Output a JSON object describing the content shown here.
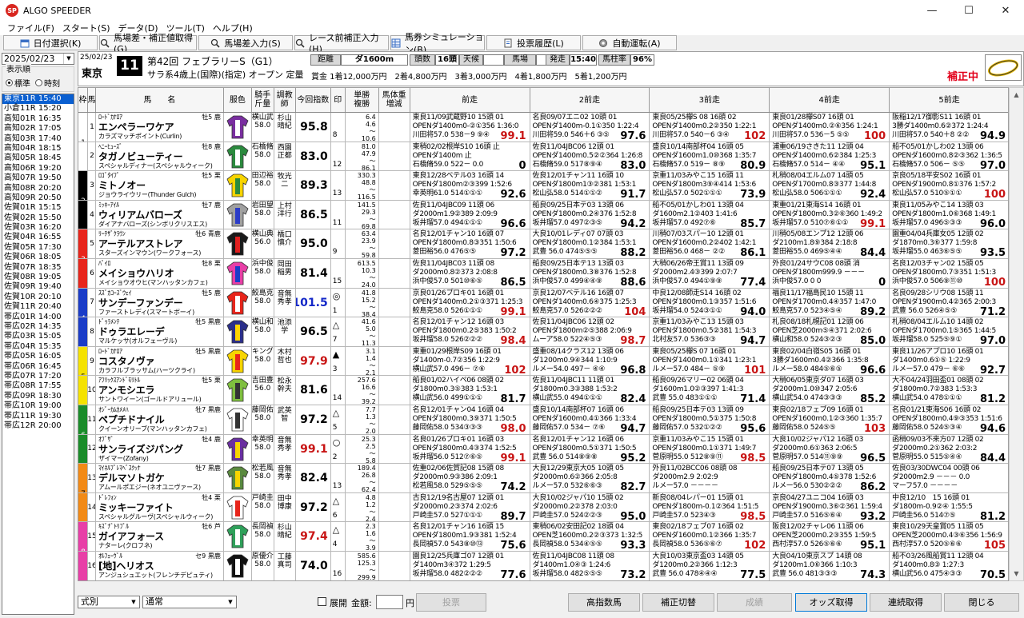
{
  "window": {
    "title": "ALGO SPEEDER",
    "app_icon": "SP"
  },
  "menu": [
    "ファイル(F)",
    "スタート(S)",
    "データ(D)",
    "ツール(T)",
    "ヘルプ(H)"
  ],
  "toolbar": [
    {
      "label": "日付選択(K)",
      "icon": "calendar-icon"
    },
    {
      "label": "馬場差・補正値取得(G)",
      "icon": "search-icon"
    },
    {
      "label": "馬場差入力(S)",
      "icon": "search-icon"
    },
    {
      "label": "レース前補正入力(H)",
      "icon": "search-icon"
    },
    {
      "label": "馬券シミュレーション(B)",
      "icon": "grid-icon"
    },
    {
      "label": "投票履歴(L)",
      "icon": "list-icon"
    },
    {
      "label": "自動運転(A)",
      "icon": "gear-icon"
    }
  ],
  "left": {
    "date": "2025/02/23",
    "order_label": "表示順",
    "order_options": [
      "標準",
      "時刻"
    ],
    "order_selected": 0,
    "races": [
      "東京11R 15:40",
      "小倉11R 15:20",
      "高知01R 16:35",
      "高知02R 17:05",
      "高知03R 17:40",
      "高知04R 18:15",
      "高知05R 18:45",
      "高知06R 19:20",
      "高知07R 19:50",
      "高知08R 20:20",
      "高知09R 20:50",
      "佐賀01R 15:15",
      "佐賀02R 15:50",
      "佐賀03R 16:20",
      "佐賀04R 16:55",
      "佐賀05R 17:30",
      "佐賀06R 18:05",
      "佐賀07R 18:35",
      "佐賀08R 19:05",
      "佐賀09R 19:40",
      "佐賀10R 20:10",
      "佐賀11R 20:40",
      "帯広01R 14:00",
      "帯広02R 14:35",
      "帯広03R 15:05",
      "帯広04R 15:35",
      "帯広05R 16:05",
      "帯広06R 16:45",
      "帯広07R 17:20",
      "帯広08R 17:55",
      "帯広09R 18:30",
      "帯広10R 19:00",
      "帯広11R 19:30",
      "帯広12R 20:00"
    ],
    "selected": 0
  },
  "header": {
    "date": "25/02/23",
    "place": "東京",
    "race_no": "11",
    "race_name": "第42回 フェブラリーS（G1）",
    "conditions": "サラ系4歳上(国際)(指定) オープン 定量",
    "distance_label": "距離",
    "distance": "ダ1600m",
    "heads_label": "頭数",
    "heads": "16頭",
    "weather_label": "天候",
    "weather": "",
    "track_label": "馬場",
    "track": "",
    "post_label": "発走",
    "post": "15:40",
    "ratio_label": "馬柱率",
    "ratio": "96%",
    "prize": "賞金 1着12,000万円　2着4,800万円　3着3,000万円　4着1,800万円　5着1,200万円",
    "status": "補正中"
  },
  "columns": [
    "枠",
    "馬",
    "馬　　名",
    "服色",
    "騎手\n斤量",
    "調教\n師",
    "今回指数",
    "印",
    "単勝\n複勝",
    "馬体重\n増減",
    "前走",
    "2前走",
    "3前走",
    "4前走",
    "5前走"
  ],
  "horses": [
    {
      "waku": "1",
      "no": "1",
      "sire": "ﾛｰﾄﾞｶﾅﾛｱ",
      "sex": "牡5 鹿",
      "name": "エンペラーワケア",
      "dam": "カラズマッチポイント(Curlin)",
      "jockey": "横山武史\n58.0",
      "trainer": "杉山晴紀",
      "index": "95.8",
      "idx_color": "#000",
      "mark": "",
      "num": "8",
      "trend": "↗",
      "odds": "6.4\n4.6\n～\n10.6",
      "runs": [
        [
          "東良11/09武蔵野10 15頭 01",
          "OPENダ1400m0-②①356 1:36:0",
          "川田将57.0 538－9 ⑨④ 99.1"
        ],
        [
          "名良09/07エニ02 10頭 01",
          "OPENダ1400m-0.1①350 1:22:4",
          "川田将59.0 546＋6 ③⑤ 97.6"
        ],
        [
          "東良05/25欅S 08 16頭 02",
          "OPENダ1400m0.2②350 1:22:1",
          "川田将57.0 540－6 ③④ 102"
        ],
        [
          "東良01/28欅S07 16頭 01",
          "OPENダ1400m0.②⑥356 1:24:1",
          "川田将57.0 536－5 ⑤⑤ 100"
        ],
        [
          "阪稲12/17御影S11 16頭 01",
          "3勝ダ1400m0.6②372 1:24:4",
          "川田将57.0 540＋8 ②② 94.9"
        ]
      ]
    },
    {
      "waku": "1",
      "no": "2",
      "sire": "ﾍﾆｰﾋｭｰｽﾞ",
      "sex": "牡8 鹿",
      "name": "タガノビューティー",
      "dam": "スペシャルディナー(スペシャルウィーク)",
      "jockey": "石橋脩\n58.0",
      "trainer": "西園正都",
      "index": "83.0",
      "idx_color": "#000",
      "mark": "",
      "num": "12",
      "trend": "↗",
      "odds": "81.0\n47.9\n～\n86.1",
      "runs": [
        [
          "東稍02/02根岸S10 16頭 止",
          "OPENダ1400m 止",
          "石橋脩59.0 522－ 0.0 0"
        ],
        [
          "佐良11/04JBC06 12頭 01",
          "OPENダ1400m0.5②②364 1:26:8",
          "石橋脩59.0 517⑧⑨④ 83.0"
        ],
        [
          "盛良10/14南部杯04 16頭 05",
          "OPENダ1600m1.0⑩368 1:35:7",
          "石橋脩57.0 519－ ⑧⑨ 80.9"
        ],
        [
          "浦重06/19さきた11 12頭 04",
          "OPENダ1400m0.6②384 1:25:3",
          "石橋脩57.0 514－ ④④ 95.1"
        ],
        [
          "船不05/01かしわ02 13頭 06",
          "OPENダ1600m0.8②③362 1:36:5",
          "石橋脩57.0 506－ ⑤⑤ 97.0"
        ]
      ]
    },
    {
      "waku": "2",
      "no": "3",
      "sire": "ﾛｺﾞﾀｲﾌﾟ",
      "sex": "牡5 栗",
      "name": "ミトノオー",
      "dam": "ジョウライウリー(Thunder Gulch)",
      "jockey": "田辺裕信\n58.0",
      "trainer": "牧光二",
      "index": "89.3",
      "idx_color": "#000",
      "mark": "",
      "num": "13",
      "trend": "～",
      "odds": "330.3\n48.8\n～\n116.5",
      "runs": [
        [
          "東良12/28ベテル03 16頭 14",
          "OPENダ1800m②③399 1:52:6",
          "幸英明61.0 514①①① 92.6"
        ],
        [
          "佐良12/01チャン11 16頭 10",
          "OPENダ1800m1③②381 1:53:1",
          "松山弘58.0 514①①② 91.7"
        ],
        [
          "京重11/03みやこ15 16頭 11",
          "OPENダ1800m3⑨④414 1:53:6",
          "松山弘57.0 502①①① 73.9"
        ],
        [
          "札稍08/04エルム07 14頭 05",
          "OPENダ1700m0.8③377 1:44:8",
          "松山弘58.0 506①①① 92.4"
        ],
        [
          "京良05/18平安S02 16頭 01",
          "OPENダ1900m0.8①376 1:57:2",
          "松山弘57.0 510⑤①① 100"
        ]
      ]
    },
    {
      "waku": "2",
      "no": "4",
      "sire": "ﾐｯｷｰｱｲﾙ",
      "sex": "牡7 鹿",
      "name": "ウィリアムバローズ",
      "dam": "ダイアナバローズ(シンボリクリスエス)",
      "jockey": "岩田望来\n58.0",
      "trainer": "上村洋行",
      "index": "86.5",
      "idx_color": "#000",
      "mark": "",
      "num": "11",
      "trend": "～",
      "odds": "141.5\n29.3\n～\n69.8",
      "runs": [
        [
          "佐良11/04JBC09 11頭 06",
          "ダ2000m1.9②389 2:09:9",
          "坂井瑠57.0 494①①① 96.6"
        ],
        [
          "船良09/25日本テ03 13頭 06",
          "OPENダ1800m0.2④376 1:52:8",
          "坂井瑠57.0 497②③⑤ 94.2"
        ],
        [
          "船不05/01かしわ01 13頭 04",
          "ダ1600m2.1②403 1:41:6",
          "坂井瑠57.0 492⑦⑥ 85.7"
        ],
        [
          "東重01/21東海S14 16頭 01",
          "OPENダ1800m0.3②⑥360 1:49:2",
          "坂井瑠57.0 510⑦⑥①① 99.1"
        ],
        [
          "東良11/05みやこ14 13頭 03",
          "OPENダ1800m1.0⑥368 1:49:1",
          "坂井瑠57.0 496⑤③③ 96.0"
        ]
      ]
    },
    {
      "waku": "3",
      "no": "5",
      "sire": "ﾘｰﾁｻﾞｸﾗｳﾝ",
      "sex": "牡6 青鹿",
      "name": "アーテルアストレア",
      "dam": "スターズインマウン(ワークフォース)",
      "jockey": "横山典弘\n56.0",
      "trainer": "橋口慎介",
      "index": "95.0",
      "idx_color": "#000",
      "mark": "",
      "num": "9",
      "trend": "～",
      "odds": "63.4\n23.9\n～\n59.8",
      "runs": [
        [
          "名良12/01チャン10 16頭 07",
          "OPENダ1800m0.8③351 1:50:6",
          "菱田裕56.0 476⑤⑤ 97.2"
        ],
        [
          "大良10/01レディ07 07頭 03",
          "OPENダ1800m0.1②384 1:53:1",
          "武豊 56.0 474⑤⑤⑤ 88.2"
        ],
        [
          "川稍07/03スパー10 12頭 01",
          "OPENダ1600m0.2②402 1:42:1",
          "菱田裕56.0 468－ ②② 86.1"
        ],
        [
          "川稍05/08エンプ12 12頭 06",
          "ダ2100m1.8⑨384 2:18:8",
          "菱田裕55.0 469⑤④④ 84.4"
        ],
        [
          "園重04/04兵庫女05 12頭 02",
          "ダ1870m0.3⑥377 1:59:8",
          "坂井瑠55.0 463⑥⑤⑤ 93.5"
        ]
      ]
    },
    {
      "waku": "3",
      "no": "6",
      "sire": "ﾊﾟｲﾛ",
      "sex": "牡8 栗",
      "name": "メイショウハリオ",
      "dam": "メイショウオウヒ(マンハッタンカフェ)",
      "jockey": "浜中俊\n58.0",
      "trainer": "岡田稲男",
      "index": "81.4",
      "idx_color": "#000",
      "mark": "",
      "num": "15",
      "trend": "～",
      "odds": "613.5\n10.3\n～\n24.0",
      "runs": [
        [
          "佐良11/04JBC03 11頭 08",
          "ダ2000m0.8②373 2:08:8",
          "浜中俊57.0 501⑩⑥⑤ 86.5"
        ],
        [
          "船良09/25日本テ13 13頭 03",
          "OPENダ1800m0.3⑧376 1:52:8",
          "浜中俊57.0 499④④⑨ 88.6"
        ],
        [
          "大稍06/26帝王賞11 13頭 09",
          "ダ2000m2.4③399 2:07:7",
          "浜中俊57.0 494①⑨⑨ 77.4"
        ],
        [
          "外良01/24サウC08 08頭 消",
          "OPENダ1800m999.9 －－－",
          "浜中俊57.0 0 0 0"
        ],
        [
          "名良12/03チャン02 15頭 05",
          "OPENダ1800m0.7③351 1:51:3",
          "浜中俊57.0 506⑨⑪⑩ 100"
        ]
      ]
    },
    {
      "waku": "4",
      "no": "7",
      "sire": "ｽｽﾞｶｺｰｽﾞｳｪｲ",
      "sex": "牡5 鹿",
      "name": "サンデーファンデー",
      "dam": "ファーストレディ(スマートボーイ)",
      "jockey": "鮫島克駿\n58.0",
      "trainer": "音無秀孝",
      "index": "101.5",
      "idx_color": "#1428c8",
      "mark": "◎",
      "num": "1",
      "trend": "↗",
      "odds": "41.8\n15.2\n～\n38.4",
      "runs": [
        [
          "京良01/26プロキ01 16頭 01",
          "OPENダ1400m0.2①③371 1:25:3",
          "鮫島克58.0 526①①① 99.1"
        ],
        [
          "京良12/07ベテル16 16頭 07",
          "OPENダ1400m0.6④375 1:25:3",
          "鮫島克57.0 526②②② 104"
        ],
        [
          "中良12/08師走S14 16頭 02",
          "OPENダ1800m0.1③357 1:51:6",
          "坂井瑠54.0 524③①① 94.0"
        ],
        [
          "福良11/17福島民10 15頭 11",
          "OPENダ1700m0.4④357 1:47:0",
          "鮫島克57.0 523④⑤④ 89.2"
        ],
        [
          "名良09/28シリウ08 15頭 11",
          "OPENダ1900m0.4②365 2:00:3",
          "武豊 56.0 526④⑤⑤ 71.2"
        ]
      ]
    },
    {
      "waku": "4",
      "no": "8",
      "sire": "ﾄﾞｩﾗﾒﾝﾃ",
      "sex": "牡5 黒鹿",
      "name": "ドゥラエレーデ",
      "dam": "マルケッサ(オルフェーヴル)",
      "jockey": "横山和生\n58.0",
      "trainer": "池添学",
      "index": "96.5",
      "idx_color": "#000",
      "mark": "△",
      "num": "7",
      "trend": "～",
      "odds": "41.6\n5.0\n～\n11.3",
      "runs": [
        [
          "名良12/01チャン12 16頭 03",
          "OPENダ1800m0.2⑤383 1:50:2",
          "坂井瑠58.0 526②②② 98.4"
        ],
        [
          "佐良11/04JBC06 12頭 02",
          "OPENダ1800m②⑤388 2:06:9",
          "ムーア58.0 522④⑤③ 98.7"
        ],
        [
          "京重11/03みやこ13 15頭 03",
          "OPENダ1800m0.5②381 1:54:3",
          "北村友57.0 536③③ 94.7"
        ],
        [
          "札良08/18札幌記01 12頭 06",
          "OPEN芝2000m⑤④371 2:02:6",
          "横山和58.0 524③②③ 85.0"
        ],
        [
          "札稍08/04エルム10 14頭 02",
          "OPENダ1700m0.1⑤365 1:44:5",
          "坂井瑠58.0 525⑤⑨① 97.0"
        ]
      ]
    },
    {
      "waku": "5",
      "no": "9",
      "sire": "ﾛｰﾄﾞｶﾅﾛｱ",
      "sex": "牡5 黒鹿",
      "name": "コスタノヴァ",
      "dam": "カラフルブラッサム(ハーツクライ)",
      "jockey": "キング\n58.0",
      "trainer": "木村哲也",
      "index": "97.9",
      "idx_color": "#c81414",
      "mark": "▲",
      "num": "3",
      "trend": "↗",
      "odds": "3.1\n1.4\n～\n2.1",
      "runs": [
        [
          "東重01/29根岸S09 16頭 01",
          "ダ1400m-0.7②356 1:22:9",
          "横山武57.0 496－ ⑦⑥ 102"
        ],
        [
          "盛重08/14クラス12 13頭 06",
          "ダ1200m0.9④344 1:10:9",
          "ルメー54.0 497－ ④④ 96.8"
        ],
        [
          "東良05/25欅S 07 16頭 01",
          "OPENダ1400m0.1①341 1:23:1",
          "ルメー57.0 484－ ⑤⑨ 101"
        ],
        [
          "東良02/04白嶺S05 16頭 01",
          "3勝ダ1600m0.4②366 1:35:8",
          "ルメー58.0 484⑤⑥⑤ 96.6"
        ],
        [
          "東良11/26アプロ10 16頭 01",
          "ダ1400m0.6①⑤ 1:22:9",
          "ルメー57.0 479－ ⑥⑥ 92.7"
        ]
      ]
    },
    {
      "waku": "5",
      "no": "10",
      "sire": "ｱﾌﾘｯｸｽｱﾝﾄﾞﾓﾘﾄﾙ",
      "sex": "牡5 栗",
      "name": "アンモシエラ",
      "dam": "サントワイーン(ゴールドアリュール)",
      "jockey": "吉田豊\n56.0",
      "trainer": "松永幹夫",
      "index": "81.6",
      "idx_color": "#000",
      "mark": "",
      "num": "14",
      "trend": "～",
      "odds": "257.6\n16.6\n～\n39.2",
      "runs": [
        [
          "船良01/02ハイペ06 08頭 02",
          "ダ1800m0.3⑤383 1:53:1",
          "横山武56.0 499①①① 81.7"
        ],
        [
          "佐良11/04JBC11 11頭 01",
          "ダ1800m0.3③388 1:53:2",
          "横山武55.0 494①①① 82.4"
        ],
        [
          "船良09/26マリー02 06頭 04",
          "ダ1600m1.0②③397 1:41:3",
          "武豊 55.0 483①①① 71.4"
        ],
        [
          "大稍06/05東京ダ07 16頭 03",
          "ダ2000m1.0⑩347 2:05:6",
          "横山武54.0 474③③③ 85.2"
        ],
        [
          "大不04/24羽田盃01 08頭 02",
          "ダ1800m0.7②383 1:53:3",
          "横山武54.0 478①①① 81.2"
        ]
      ]
    },
    {
      "waku": "6",
      "no": "11",
      "sire": "ｵｼﾞｰｶﾑｶﾒﾒﾊ",
      "sex": "牡7 黒鹿",
      "name": "ペプチドナイル",
      "dam": "クイーンオリーブ(マンハッタンカフェ)",
      "jockey": "藤岡佑介\n58.0",
      "trainer": "武英智",
      "index": "97.2",
      "idx_color": "#000",
      "mark": "△",
      "num": "5",
      "trend": "～",
      "odds": "7.7\n1.3\n～\n2.0",
      "runs": [
        [
          "名良12/01チャン04 16頭 04",
          "OPENダ1800m0.3⑨371 1:50:5",
          "藤岡佑58.0 534③③③ 98.0"
        ],
        [
          "盛良10/14南部杯07 16頭 06",
          "OPENダ1600m0.4①366 1:33:4",
          "藤岡佑57.0 534－ ⑦⑥ 94.7"
        ],
        [
          "船良09/25日本テ03 13頭 09",
          "OPENダ1800m0.5①375 1:50:8",
          "藤岡佑57.0 532①②② 95.6"
        ],
        [
          "東良02/18フェブ09 16頭 01",
          "OPENダ1600m0.1②③360 1:35:7",
          "藤岡佑58.0 524⑤⑤ 103"
        ],
        [
          "名良01/21東海S06 16頭 02",
          "OPENダ1800m0.4⑨③353 1:51:6",
          "藤岡佑58.0 524⑤③④ 94.6"
        ]
      ]
    },
    {
      "waku": "6",
      "no": "12",
      "sire": "ｵﾌﾞｻﾞ",
      "sex": "牡4 鹿",
      "name": "サンライズジパング",
      "dam": "ザイマー(Zofany)",
      "jockey": "幸英明\n58.0",
      "trainer": "音無秀孝",
      "index": "99.1",
      "idx_color": "#c81414",
      "mark": "○",
      "num": "2",
      "trend": "～",
      "odds": "25.3\n2.5\n～\n5.8",
      "runs": [
        [
          "名良01/26プロキ01 16頭 03",
          "OPENダ1800m0.4③374 1:52:5",
          "坂井瑠56.0 512⑦⑥⑤ 99.1"
        ],
        [
          "名良12/01チャン12 16頭 06",
          "OPENダ1800m0.5①371 1:50:5",
          "武豊 56.0 514⑧⑨⑧ 95.2"
        ],
        [
          "京重11/03みやこ15 15頭 01",
          "OPENダ1800m0.1①371 1:49:7",
          "菅原明55.0 512⑧⑨⑪ 98.5"
        ],
        [
          "大良10/02ジャパ12 16頭 03",
          "ダ2000m0.6①363 2:06:5",
          "菅原明57.0 514⑪⑨⑨ 96.5"
        ],
        [
          "函稍09/03不来方07 12頭 02",
          "ダ2000m0.2①362 2:03:2",
          "菅原明55.0 515⑤④④ 84.4"
        ]
      ]
    },
    {
      "waku": "7",
      "no": "13",
      "sire": "ﾏｲﾈﾙﾌﾟﾚﾏﾍﾞｽｸｯﾅ",
      "sex": "牡7 黒鹿",
      "name": "デルマソトガケ",
      "dam": "アムールポエジー(ネオユニヴァース)",
      "jockey": "松若風馬\n58.0",
      "trainer": "音無秀孝",
      "index": "82.4",
      "idx_color": "#000",
      "mark": "",
      "num": "13",
      "trend": "～",
      "odds": "189.4\n26.8\n～\n62.4",
      "runs": [
        [
          "佐重02/06佐賀記08 15頭 08",
          "ダ2000m0.9③386 2:09:1",
          "松若風58.0 529⑤⑤⑤ 74.2"
        ],
        [
          "大良12/29東京大05 10頭 05",
          "ダ2000m0.6②366 2:05:8",
          "ルメー57.0 532⑥⑥③ 82.7"
        ],
        [
          "外良11/02BCC06 08頭 08",
          "ダ2000m2.9 2:02:9",
          "ルメー57.0 －－－－"
        ],
        [
          "船良09/25日本テ07 13頭 05",
          "OPENダ1800m0.4⑤378 1:52:6",
          "ルメー56.0 530②②② 86.2"
        ],
        [
          "佐良03/30DWC04 00頭 06",
          "ダ2000m2.9 －－－ 0.0",
          "マーフ57.0 －－－－"
        ]
      ]
    },
    {
      "waku": "7",
      "no": "14",
      "sire": "ﾄﾞﾚﾌｫﾝ",
      "sex": "牡4 栗",
      "name": "ミッキーファイト",
      "dam": "スペシャルグルーヴ(スペシャルウィーク)",
      "jockey": "戸崎圭太\n58.0",
      "trainer": "田中博康",
      "index": "97.2",
      "idx_color": "#000",
      "mark": "△",
      "num": "6",
      "trend": "～",
      "odds": "4.8\n1.2\n～\n2.4",
      "runs": [
        [
          "古良12/19名古屋07 12頭 01",
          "ダ2000m0.2③374 2:02:6",
          "戸崎圭57.0 527①①① 89.7"
        ],
        [
          "大良10/02ジャパ10 15頭 02",
          "ダ2000m0.2②378 2:03:0",
          "戸崎圭57.0 524②②③ 95.0"
        ],
        [
          "新良08/04レパー01 15頭 01",
          "OPENダ1800m-0.1②364 1:51:5",
          "戸崎圭57.0 523④③ 98.5"
        ],
        [
          "京良04/27ユニコ04 16頭 03",
          "OPENダ1900m0.3⑥②361 1:59:4",
          "戸崎圭57.0 516⑤⑥④ 93.2"
        ],
        [
          "中良12/10　15 16頭 01",
          "ダ1800m-0.9②④ 1:55:5",
          "戸崎圭56.0 514⑦⑤ 81.2"
        ]
      ]
    },
    {
      "waku": "8",
      "no": "15",
      "sire": "ｷｽﾞﾅﾞﾄﾘﾌﾟﾙ",
      "sex": "牡6 芦",
      "name": "ガイアフォース",
      "dam": "ナターレ(クロフネ)",
      "jockey": "長岡禎仁\n58.0",
      "trainer": "杉山晴紀",
      "index": "97.4",
      "idx_color": "#c81414",
      "mark": "△",
      "num": "4",
      "trend": "～",
      "odds": "2.3\n1.6\n～\n3.9",
      "runs": [
        [
          "名良12/01チャン16 16頭 15",
          "OPENダ1800m1.9③381 1:52:4",
          "長岡禎57.0 543⑧⑩⑬ 75.6"
        ],
        [
          "東稍06/02安田記02 18頭 04",
          "OPEN芝1600m0.2②③373 1:32:5",
          "長岡禎58.0 534④⑤⑤ 93.3"
        ],
        [
          "東良02/18フェブ07 16頭 02",
          "OPENダ1600m0.1②366 1:35:7",
          "長岡禎58.0 536⑤⑥⑦ 102"
        ],
        [
          "阪良12/02チャレ06 11頭 06",
          "OPEN芝2000m0.2③355 1:59:5",
          "西村淳57.0 526⑤⑥⑥ 95.1"
        ],
        [
          "東良10/29天皇賞05 11頭 05",
          "OPEN芝2000m0.4③⑥356 1:56:9",
          "西村淳57.0 520⑤⑥⑥ 105"
        ]
      ]
    },
    {
      "waku": "8",
      "no": "16",
      "sire": "ｵﾙﾌｪｰｳﾞﾙ",
      "sex": "セ9 黒鹿",
      "name": "[地]ヘリオス",
      "dam": "アンジュシュエット(フレンチデピュティ)",
      "jockey": "原優介\n58.0",
      "trainer": "工藤真司",
      "index": "74.0",
      "idx_color": "#000",
      "mark": "",
      "num": "16",
      "trend": "～",
      "odds": "585.6\n125.3\n～\n299.9",
      "runs": [
        [
          "園良12/25兵庫ゴ07 12頭 01",
          "ダ1400m3④372 1:29:5",
          "坂井瑠58.0 482②②② 77.6"
        ],
        [
          "佐良11/04JBC08 11頭 08",
          "ダ1400m1.0④③ 1:24:6",
          "坂井瑠58.0 482⑤⑤⑤ 73.2"
        ],
        [
          "大良10/03東京盃03 14頭 05",
          "ダ1200m0.2②366 1:12:3",
          "武豊 56.0 478④④④ 77.5"
        ],
        [
          "大良04/10東京スプ 14頭 08",
          "ダ1200m1.0⑥366 1:10:3",
          "武豊 56.0 481③③③ 74.3"
        ],
        [
          "船不03/26風船賞11 12頭 04",
          "ダ1400m0.8③ 1:27:3",
          "横山武56.0 475④③③ 70.5"
        ]
      ]
    }
  ],
  "bottom": {
    "sel1": "式別",
    "sel2": "通常",
    "expand_label": "展開",
    "amount_label": "金額:",
    "amount_unit": "円",
    "buttons": [
      "投票",
      "高指数馬",
      "補正切替",
      "成績",
      "オッズ取得",
      "連続取得",
      "閉じる"
    ]
  },
  "colors": {
    "waku": [
      "#ffffff",
      "#000000",
      "#e8251b",
      "#1a3cc8",
      "#f5e200",
      "#1a8c2a",
      "#f28a16",
      "#e83fa7"
    ],
    "selected": "#0a5fd1",
    "alert": "#e2001a"
  }
}
